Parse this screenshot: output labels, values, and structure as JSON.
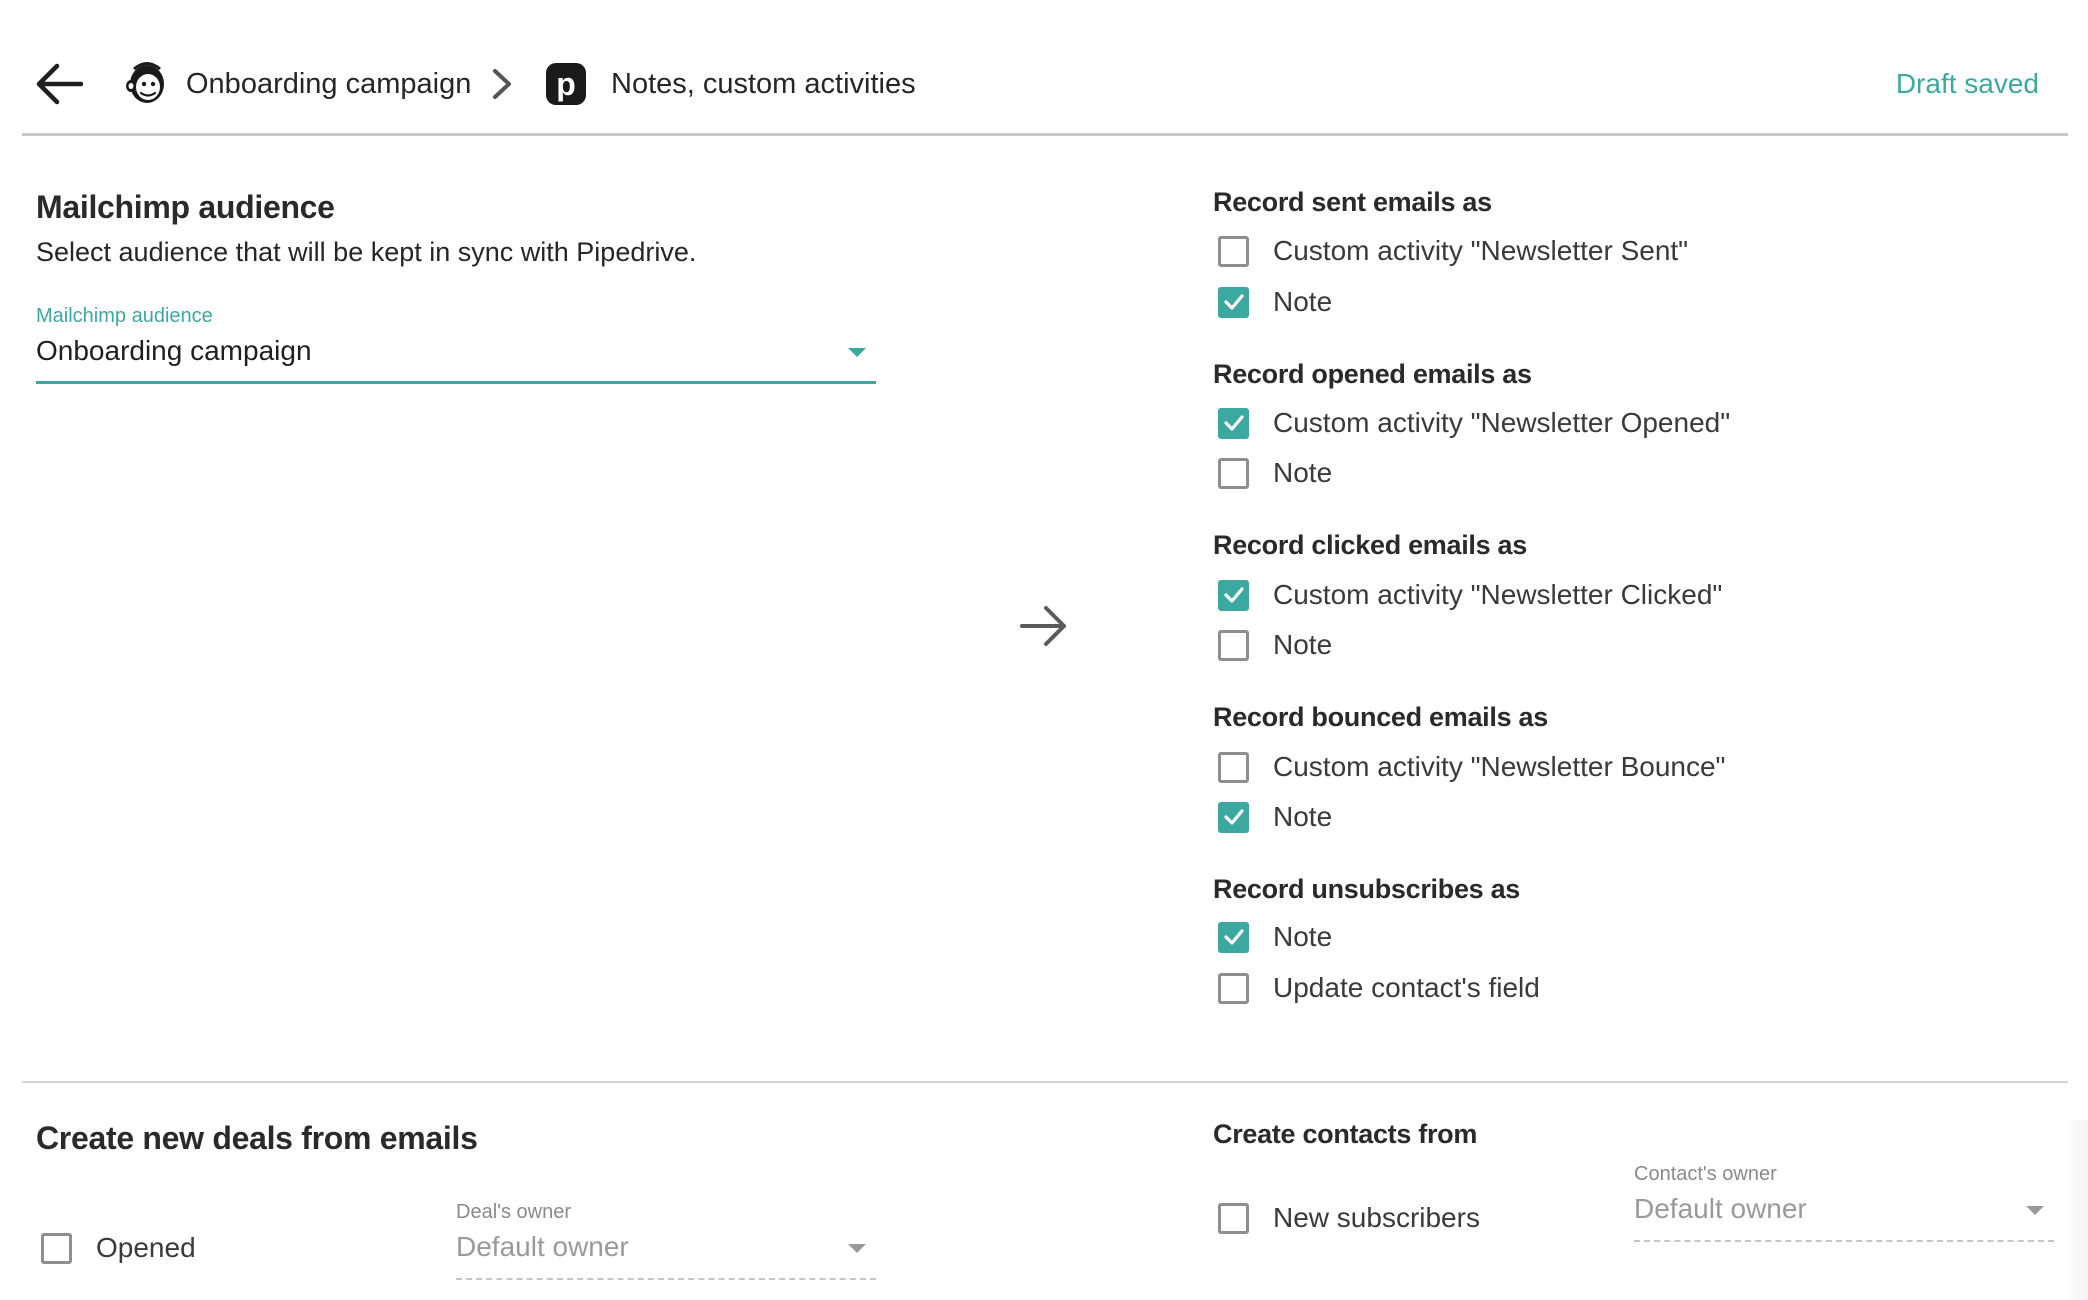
{
  "header": {
    "breadcrumb_source": "Onboarding campaign",
    "breadcrumb_target": "Notes, custom activities",
    "status": "Draft saved",
    "source_logo_icon": "mailchimp-logo-icon",
    "target_logo_icon": "pipedrive-logo-icon",
    "target_logo_letter": "p"
  },
  "audience": {
    "title": "Mailchimp audience",
    "description": "Select audience that will be kept in sync with Pipedrive.",
    "field_label": "Mailchimp audience",
    "selected": "Onboarding campaign"
  },
  "record_groups": [
    {
      "title": "Record sent emails as",
      "options": [
        {
          "label": "Custom activity \"Newsletter Sent\"",
          "checked": false
        },
        {
          "label": "Note",
          "checked": true
        }
      ]
    },
    {
      "title": "Record opened emails as",
      "options": [
        {
          "label": "Custom activity \"Newsletter Opened\"",
          "checked": true
        },
        {
          "label": "Note",
          "checked": false
        }
      ]
    },
    {
      "title": "Record clicked emails as",
      "options": [
        {
          "label": "Custom activity \"Newsletter Clicked\"",
          "checked": true
        },
        {
          "label": "Note",
          "checked": false
        }
      ]
    },
    {
      "title": "Record bounced emails as",
      "options": [
        {
          "label": "Custom activity \"Newsletter Bounce\"",
          "checked": false
        },
        {
          "label": "Note",
          "checked": true
        }
      ]
    },
    {
      "title": "Record unsubscribes as",
      "options": [
        {
          "label": "Note",
          "checked": true
        },
        {
          "label": "Update contact's field",
          "checked": false
        }
      ]
    }
  ],
  "deals": {
    "title": "Create new deals from emails",
    "option_label": "Opened",
    "option_checked": false,
    "owner_label": "Deal's owner",
    "owner_value": "Default owner"
  },
  "contacts": {
    "title": "Create contacts from",
    "option_label": "New subscribers",
    "option_checked": false,
    "owner_label": "Contact's owner",
    "owner_value": "Default owner"
  },
  "colors": {
    "accent": "#3ca9a1",
    "checkbox_border": "#8e8e8e",
    "divider": "#c9c9c9"
  }
}
